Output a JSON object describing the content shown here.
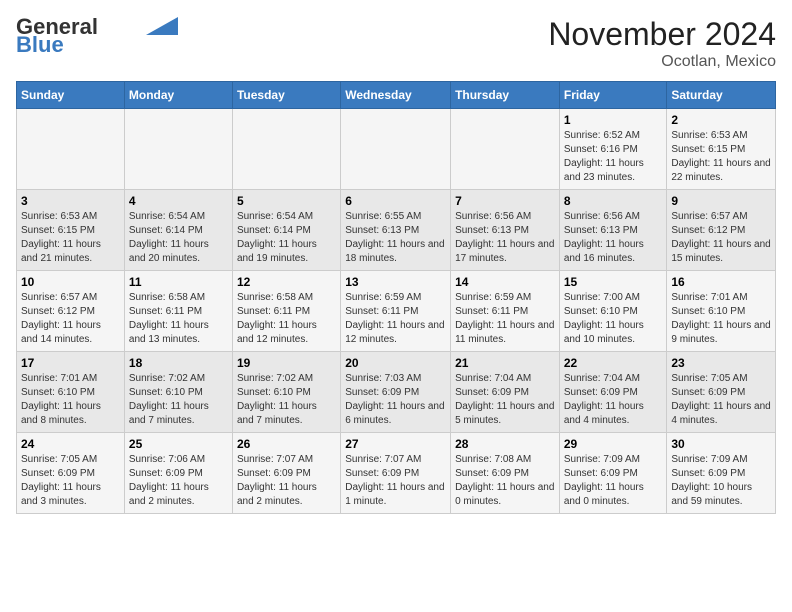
{
  "logo": {
    "general": "General",
    "blue": "Blue"
  },
  "title": "November 2024",
  "subtitle": "Ocotlan, Mexico",
  "weekdays": [
    "Sunday",
    "Monday",
    "Tuesday",
    "Wednesday",
    "Thursday",
    "Friday",
    "Saturday"
  ],
  "weeks": [
    [
      {
        "day": "",
        "info": ""
      },
      {
        "day": "",
        "info": ""
      },
      {
        "day": "",
        "info": ""
      },
      {
        "day": "",
        "info": ""
      },
      {
        "day": "",
        "info": ""
      },
      {
        "day": "1",
        "info": "Sunrise: 6:52 AM\nSunset: 6:16 PM\nDaylight: 11 hours and 23 minutes."
      },
      {
        "day": "2",
        "info": "Sunrise: 6:53 AM\nSunset: 6:15 PM\nDaylight: 11 hours and 22 minutes."
      }
    ],
    [
      {
        "day": "3",
        "info": "Sunrise: 6:53 AM\nSunset: 6:15 PM\nDaylight: 11 hours and 21 minutes."
      },
      {
        "day": "4",
        "info": "Sunrise: 6:54 AM\nSunset: 6:14 PM\nDaylight: 11 hours and 20 minutes."
      },
      {
        "day": "5",
        "info": "Sunrise: 6:54 AM\nSunset: 6:14 PM\nDaylight: 11 hours and 19 minutes."
      },
      {
        "day": "6",
        "info": "Sunrise: 6:55 AM\nSunset: 6:13 PM\nDaylight: 11 hours and 18 minutes."
      },
      {
        "day": "7",
        "info": "Sunrise: 6:56 AM\nSunset: 6:13 PM\nDaylight: 11 hours and 17 minutes."
      },
      {
        "day": "8",
        "info": "Sunrise: 6:56 AM\nSunset: 6:13 PM\nDaylight: 11 hours and 16 minutes."
      },
      {
        "day": "9",
        "info": "Sunrise: 6:57 AM\nSunset: 6:12 PM\nDaylight: 11 hours and 15 minutes."
      }
    ],
    [
      {
        "day": "10",
        "info": "Sunrise: 6:57 AM\nSunset: 6:12 PM\nDaylight: 11 hours and 14 minutes."
      },
      {
        "day": "11",
        "info": "Sunrise: 6:58 AM\nSunset: 6:11 PM\nDaylight: 11 hours and 13 minutes."
      },
      {
        "day": "12",
        "info": "Sunrise: 6:58 AM\nSunset: 6:11 PM\nDaylight: 11 hours and 12 minutes."
      },
      {
        "day": "13",
        "info": "Sunrise: 6:59 AM\nSunset: 6:11 PM\nDaylight: 11 hours and 12 minutes."
      },
      {
        "day": "14",
        "info": "Sunrise: 6:59 AM\nSunset: 6:11 PM\nDaylight: 11 hours and 11 minutes."
      },
      {
        "day": "15",
        "info": "Sunrise: 7:00 AM\nSunset: 6:10 PM\nDaylight: 11 hours and 10 minutes."
      },
      {
        "day": "16",
        "info": "Sunrise: 7:01 AM\nSunset: 6:10 PM\nDaylight: 11 hours and 9 minutes."
      }
    ],
    [
      {
        "day": "17",
        "info": "Sunrise: 7:01 AM\nSunset: 6:10 PM\nDaylight: 11 hours and 8 minutes."
      },
      {
        "day": "18",
        "info": "Sunrise: 7:02 AM\nSunset: 6:10 PM\nDaylight: 11 hours and 7 minutes."
      },
      {
        "day": "19",
        "info": "Sunrise: 7:02 AM\nSunset: 6:10 PM\nDaylight: 11 hours and 7 minutes."
      },
      {
        "day": "20",
        "info": "Sunrise: 7:03 AM\nSunset: 6:09 PM\nDaylight: 11 hours and 6 minutes."
      },
      {
        "day": "21",
        "info": "Sunrise: 7:04 AM\nSunset: 6:09 PM\nDaylight: 11 hours and 5 minutes."
      },
      {
        "day": "22",
        "info": "Sunrise: 7:04 AM\nSunset: 6:09 PM\nDaylight: 11 hours and 4 minutes."
      },
      {
        "day": "23",
        "info": "Sunrise: 7:05 AM\nSunset: 6:09 PM\nDaylight: 11 hours and 4 minutes."
      }
    ],
    [
      {
        "day": "24",
        "info": "Sunrise: 7:05 AM\nSunset: 6:09 PM\nDaylight: 11 hours and 3 minutes."
      },
      {
        "day": "25",
        "info": "Sunrise: 7:06 AM\nSunset: 6:09 PM\nDaylight: 11 hours and 2 minutes."
      },
      {
        "day": "26",
        "info": "Sunrise: 7:07 AM\nSunset: 6:09 PM\nDaylight: 11 hours and 2 minutes."
      },
      {
        "day": "27",
        "info": "Sunrise: 7:07 AM\nSunset: 6:09 PM\nDaylight: 11 hours and 1 minute."
      },
      {
        "day": "28",
        "info": "Sunrise: 7:08 AM\nSunset: 6:09 PM\nDaylight: 11 hours and 0 minutes."
      },
      {
        "day": "29",
        "info": "Sunrise: 7:09 AM\nSunset: 6:09 PM\nDaylight: 11 hours and 0 minutes."
      },
      {
        "day": "30",
        "info": "Sunrise: 7:09 AM\nSunset: 6:09 PM\nDaylight: 10 hours and 59 minutes."
      }
    ]
  ]
}
